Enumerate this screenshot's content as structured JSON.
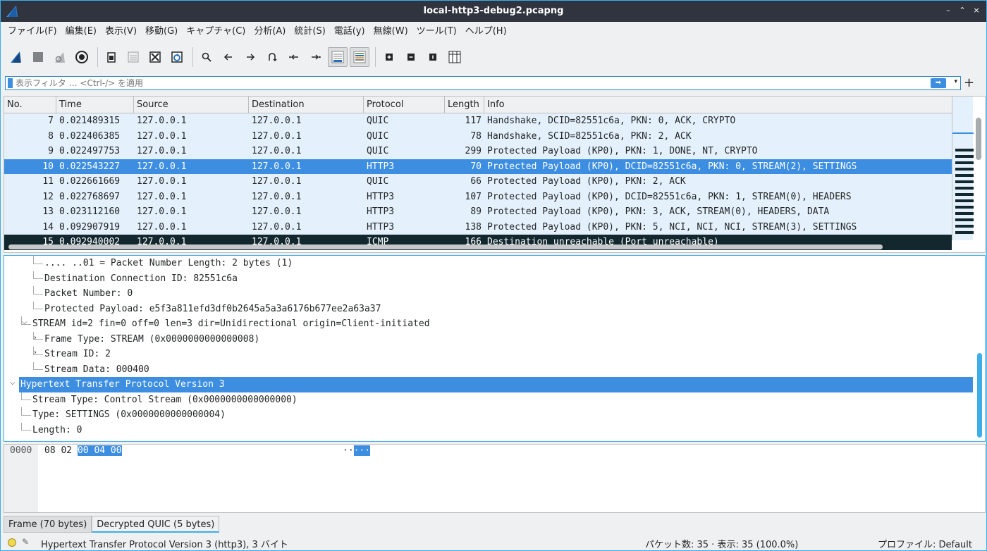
{
  "window": {
    "title": "local-http3-debug2.pcapng",
    "buttons": [
      "–",
      "⌃",
      "×"
    ]
  },
  "menu": [
    "ファイル(F)",
    "編集(E)",
    "表示(V)",
    "移動(G)",
    "キャプチャ(C)",
    "分析(A)",
    "統計(S)",
    "電話(y)",
    "無線(W)",
    "ツール(T)",
    "ヘルプ(H)"
  ],
  "toolbar": {
    "icons": [
      "shark-fin-start-icon",
      "stop-square-icon",
      "restart-fin-icon",
      "capture-options-gear-icon",
      "open-file-icon",
      "save-file-icon",
      "close-file-icon",
      "reload-file-icon",
      "find-magnifier-icon",
      "go-back-arrow-icon",
      "go-forward-arrow-icon",
      "go-to-packet-icon",
      "first-packet-icon",
      "last-packet-icon",
      "autoscroll-icon",
      "colorize-icon",
      "zoom-in-icon",
      "zoom-out-icon",
      "normal-size-icon",
      "resize-columns-icon"
    ]
  },
  "filter": {
    "placeholder": "表示フィルタ … <Ctrl-/> を適用",
    "plus": "+"
  },
  "packet_list": {
    "columns": [
      "No.",
      "Time",
      "Source",
      "Destination",
      "Protocol",
      "Length",
      "Info"
    ],
    "rows": [
      {
        "no": "7",
        "time": "0.021489315",
        "src": "127.0.0.1",
        "dst": "127.0.0.1",
        "proto": "QUIC",
        "len": "117",
        "info": "Handshake, DCID=82551c6a, PKN: 0, ACK, CRYPTO"
      },
      {
        "no": "8",
        "time": "0.022406385",
        "src": "127.0.0.1",
        "dst": "127.0.0.1",
        "proto": "QUIC",
        "len": "78",
        "info": "Handshake, SCID=82551c6a, PKN: 2, ACK"
      },
      {
        "no": "9",
        "time": "0.022497753",
        "src": "127.0.0.1",
        "dst": "127.0.0.1",
        "proto": "QUIC",
        "len": "299",
        "info": "Protected Payload (KP0), PKN: 1, DONE, NT, CRYPTO"
      },
      {
        "no": "10",
        "time": "0.022543227",
        "src": "127.0.0.1",
        "dst": "127.0.0.1",
        "proto": "HTTP3",
        "len": "70",
        "info": "Protected Payload (KP0), DCID=82551c6a, PKN: 0, STREAM(2), SETTINGS",
        "selected": true
      },
      {
        "no": "11",
        "time": "0.022661669",
        "src": "127.0.0.1",
        "dst": "127.0.0.1",
        "proto": "QUIC",
        "len": "66",
        "info": "Protected Payload (KP0), PKN: 2, ACK"
      },
      {
        "no": "12",
        "time": "0.022768697",
        "src": "127.0.0.1",
        "dst": "127.0.0.1",
        "proto": "HTTP3",
        "len": "107",
        "info": "Protected Payload (KP0), DCID=82551c6a, PKN: 1, STREAM(0), HEADERS"
      },
      {
        "no": "13",
        "time": "0.023112160",
        "src": "127.0.0.1",
        "dst": "127.0.0.1",
        "proto": "HTTP3",
        "len": "89",
        "info": "Protected Payload (KP0), PKN: 3, ACK, STREAM(0), HEADERS, DATA"
      },
      {
        "no": "14",
        "time": "0.092907919",
        "src": "127.0.0.1",
        "dst": "127.0.0.1",
        "proto": "HTTP3",
        "len": "138",
        "info": "Protected Payload (KP0), PKN: 5, NCI, NCI, NCI, STREAM(3), SETTINGS"
      },
      {
        "no": "15",
        "time": "0.092940002",
        "src": "127.0.0.1",
        "dst": "127.0.0.1",
        "proto": "ICMP",
        "len": "166",
        "info": "Destination unreachable (Port unreachable)",
        "icmp": true
      }
    ]
  },
  "details": [
    {
      "text": ".... ..01 = Packet Number Length: 2 bytes (1)",
      "indent": 3
    },
    {
      "text": "Destination Connection ID: 82551c6a",
      "indent": 3
    },
    {
      "text": "Packet Number: 0",
      "indent": 3
    },
    {
      "text": "Protected Payload: e5f3a811efd3df0b2645a5a3a6176b677ee2a63a37",
      "indent": 3
    },
    {
      "text": "STREAM id=2 fin=0 off=0 len=3 dir=Unidirectional origin=Client-initiated",
      "indent": 2,
      "arrow": "expanded"
    },
    {
      "text": "Frame Type: STREAM (0x0000000000000008)",
      "indent": 3,
      "arrow": "collapsed"
    },
    {
      "text": "Stream ID: 2",
      "indent": 3,
      "arrow": "collapsed"
    },
    {
      "text": "Stream Data: 000400",
      "indent": 3
    },
    {
      "text": "Hypertext Transfer Protocol Version 3",
      "indent": 1,
      "arrow": "expanded",
      "selected": true
    },
    {
      "text": "Stream Type: Control Stream (0x0000000000000000)",
      "indent": 2
    },
    {
      "text": "Type: SETTINGS (0x0000000000000004)",
      "indent": 2
    },
    {
      "text": "Length: 0",
      "indent": 2
    }
  ],
  "bytes": {
    "offset": "0000",
    "hex_plain": "08 02 ",
    "hex_highlight": "00 04 00",
    "ascii_plain": "··",
    "ascii_highlight": "···"
  },
  "byte_tabs": [
    "Frame (70 bytes)",
    "Decrypted QUIC (5 bytes)"
  ],
  "status": {
    "message": "Hypertext Transfer Protocol Version 3 (http3), 3 バイト",
    "packets": "パケット数: 35 · 表示: 35 (100.0%)",
    "profile": "プロファイル: Default"
  }
}
